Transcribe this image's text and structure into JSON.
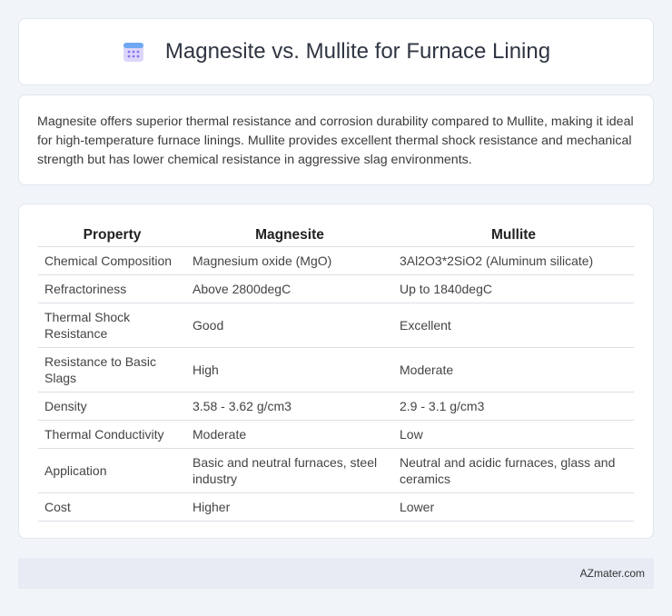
{
  "header": {
    "title": "Magnesite vs. Mullite for Furnace Lining",
    "icon": "calendar-icon",
    "icon_color": "#7b68ee"
  },
  "summary": {
    "text": "Magnesite offers superior thermal resistance and corrosion durability compared to Mullite, making it ideal for high-temperature furnace linings. Mullite provides excellent thermal shock resistance and mechanical strength but has lower chemical resistance in aggressive slag environments."
  },
  "table": {
    "headers": [
      "Property",
      "Magnesite",
      "Mullite"
    ],
    "rows": [
      [
        "Chemical Composition",
        "Magnesium oxide (MgO)",
        "3Al2O3*2SiO2 (Aluminum silicate)"
      ],
      [
        "Refractoriness",
        "Above 2800degC",
        "Up to 1840degC"
      ],
      [
        "Thermal Shock Resistance",
        "Good",
        "Excellent"
      ],
      [
        "Resistance to Basic Slags",
        "High",
        "Moderate"
      ],
      [
        "Density",
        "3.58 - 3.62 g/cm3",
        "2.9 - 3.1 g/cm3"
      ],
      [
        "Thermal Conductivity",
        "Moderate",
        "Low"
      ],
      [
        "Application",
        "Basic and neutral furnaces, steel industry",
        "Neutral and acidic furnaces, glass and ceramics"
      ],
      [
        "Cost",
        "Higher",
        "Lower"
      ]
    ]
  },
  "footer": {
    "brand": "AZmater.com"
  }
}
